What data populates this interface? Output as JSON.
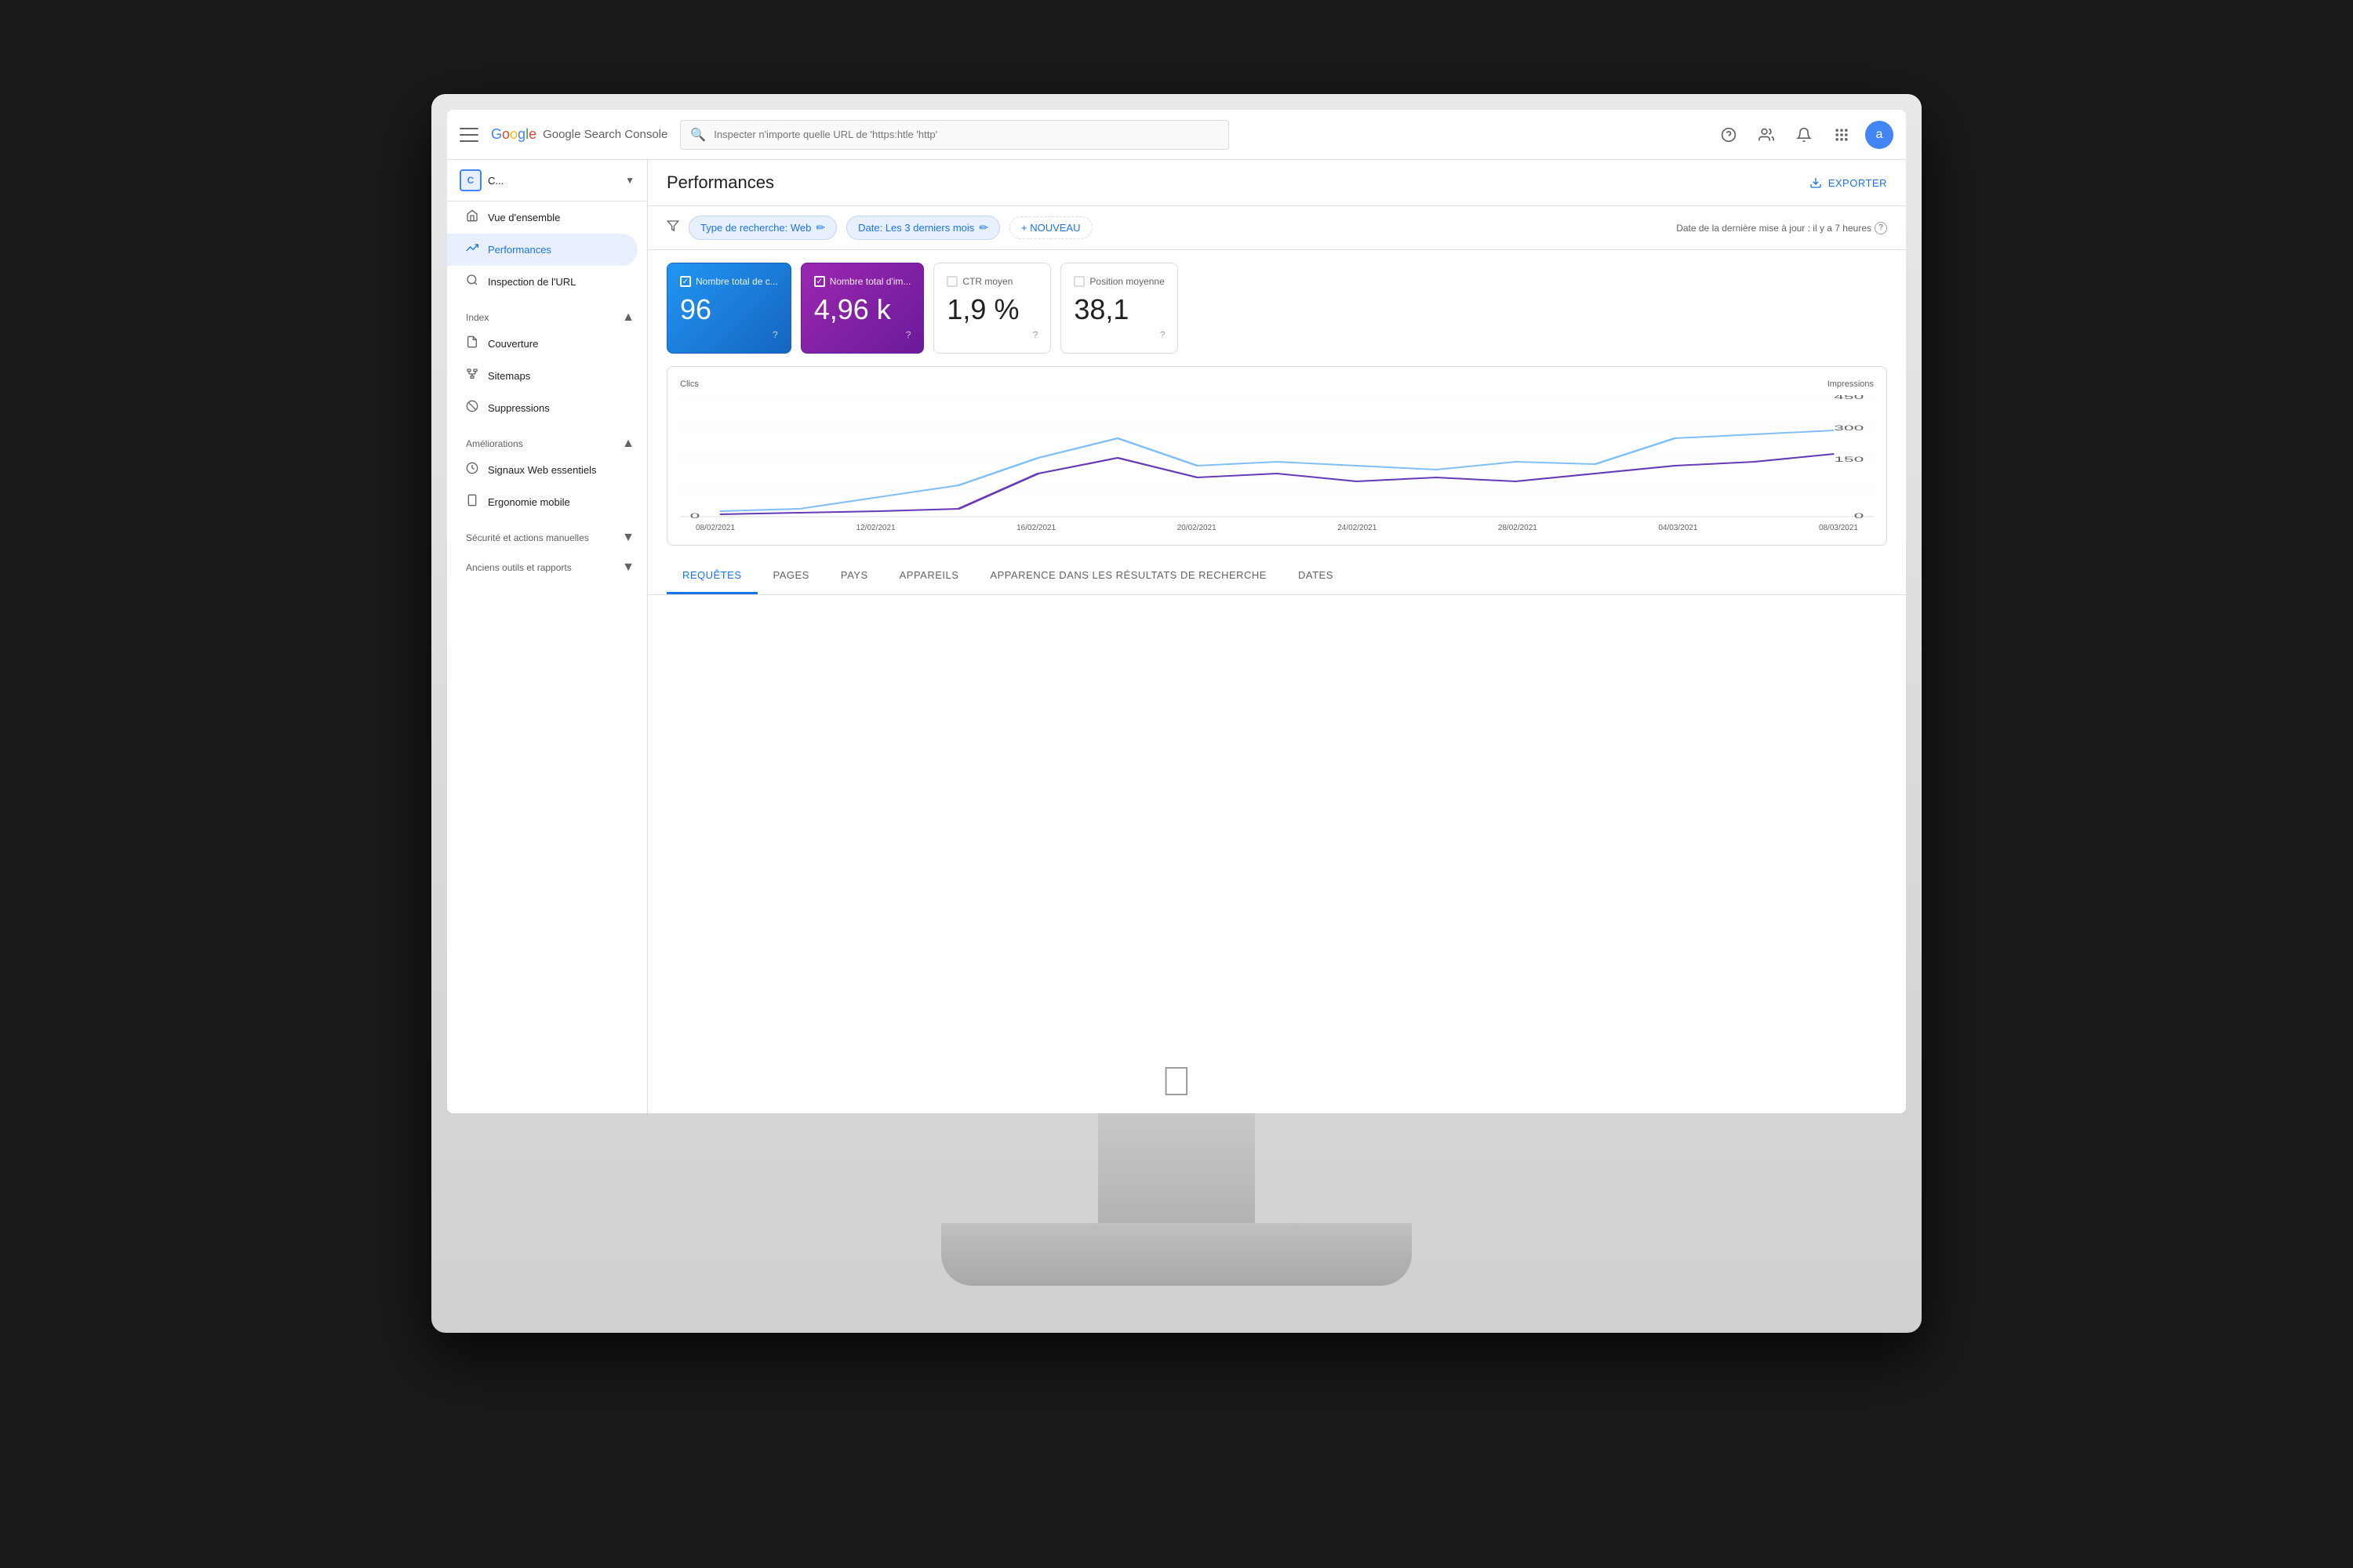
{
  "topbar": {
    "logo_text": "Google Search Console",
    "search_placeholder": "Inspecter n'importe quelle URL de 'https:htle 'http'",
    "hamburger_label": "Menu",
    "help_label": "Aide",
    "accounts_label": "Comptes",
    "notifications_label": "Notifications",
    "apps_label": "Applications",
    "avatar_label": "a"
  },
  "sidebar": {
    "site_name": "C...",
    "nav_items": [
      {
        "id": "overview",
        "label": "Vue d'ensemble",
        "icon": "🏠"
      },
      {
        "id": "performances",
        "label": "Performances",
        "icon": "📈"
      },
      {
        "id": "url-inspection",
        "label": "Inspection de l'URL",
        "icon": "🔍"
      }
    ],
    "index_section": {
      "label": "Index",
      "items": [
        {
          "id": "couverture",
          "label": "Couverture",
          "icon": "📄"
        },
        {
          "id": "sitemaps",
          "label": "Sitemaps",
          "icon": "🗺"
        },
        {
          "id": "suppressions",
          "label": "Suppressions",
          "icon": "🚫"
        }
      ]
    },
    "ameliorations_section": {
      "label": "Améliorations",
      "items": [
        {
          "id": "signaux-web",
          "label": "Signaux Web essentiels",
          "icon": "⚡"
        },
        {
          "id": "ergonomie",
          "label": "Ergonomie mobile",
          "icon": "📱"
        }
      ]
    },
    "securite_section": {
      "label": "Sécurité et actions manuelles"
    },
    "anciens_outils_section": {
      "label": "Anciens outils et rapports"
    }
  },
  "main": {
    "title": "Performances",
    "export_label": "EXPORTER",
    "filters": {
      "filter_icon": "⚙",
      "type_filter": "Type de recherche: Web",
      "date_filter": "Date: Les 3 derniers mois",
      "new_filter": "+ NOUVEAU",
      "date_info": "Date de la dernière mise à jour : il y a 7 heures"
    },
    "metrics": [
      {
        "id": "clics",
        "label": "Nombre total de c...",
        "value": "96",
        "active": true,
        "color": "blue"
      },
      {
        "id": "impressions",
        "label": "Nombre total d'im...",
        "value": "4,96 k",
        "active": true,
        "color": "purple"
      },
      {
        "id": "ctr",
        "label": "CTR moyen",
        "value": "1,9 %",
        "active": false,
        "color": "none"
      },
      {
        "id": "position",
        "label": "Position moyenne",
        "value": "38,1",
        "active": false,
        "color": "none"
      }
    ],
    "chart": {
      "left_label": "Clics",
      "right_label": "Impressions",
      "y_axis_left": [
        "0"
      ],
      "y_axis_right": [
        "450",
        "300",
        "150",
        "0"
      ],
      "x_axis": [
        "08/02/2021",
        "12/02/2021",
        "16/02/2021",
        "20/02/2021",
        "24/02/2021",
        "28/02/2021",
        "04/03/2021",
        "08/03/2021"
      ]
    },
    "tabs": [
      {
        "id": "requetes",
        "label": "REQUÊTES",
        "active": true
      },
      {
        "id": "pages",
        "label": "PAGES",
        "active": false
      },
      {
        "id": "pays",
        "label": "PAYS",
        "active": false
      },
      {
        "id": "appareils",
        "label": "APPAREILS",
        "active": false
      },
      {
        "id": "apparence",
        "label": "APPARENCE DANS LES RÉSULTATS DE RECHERCHE",
        "active": false
      },
      {
        "id": "dates",
        "label": "DATES",
        "active": false
      }
    ]
  },
  "monitor": {
    "apple_logo": ""
  }
}
